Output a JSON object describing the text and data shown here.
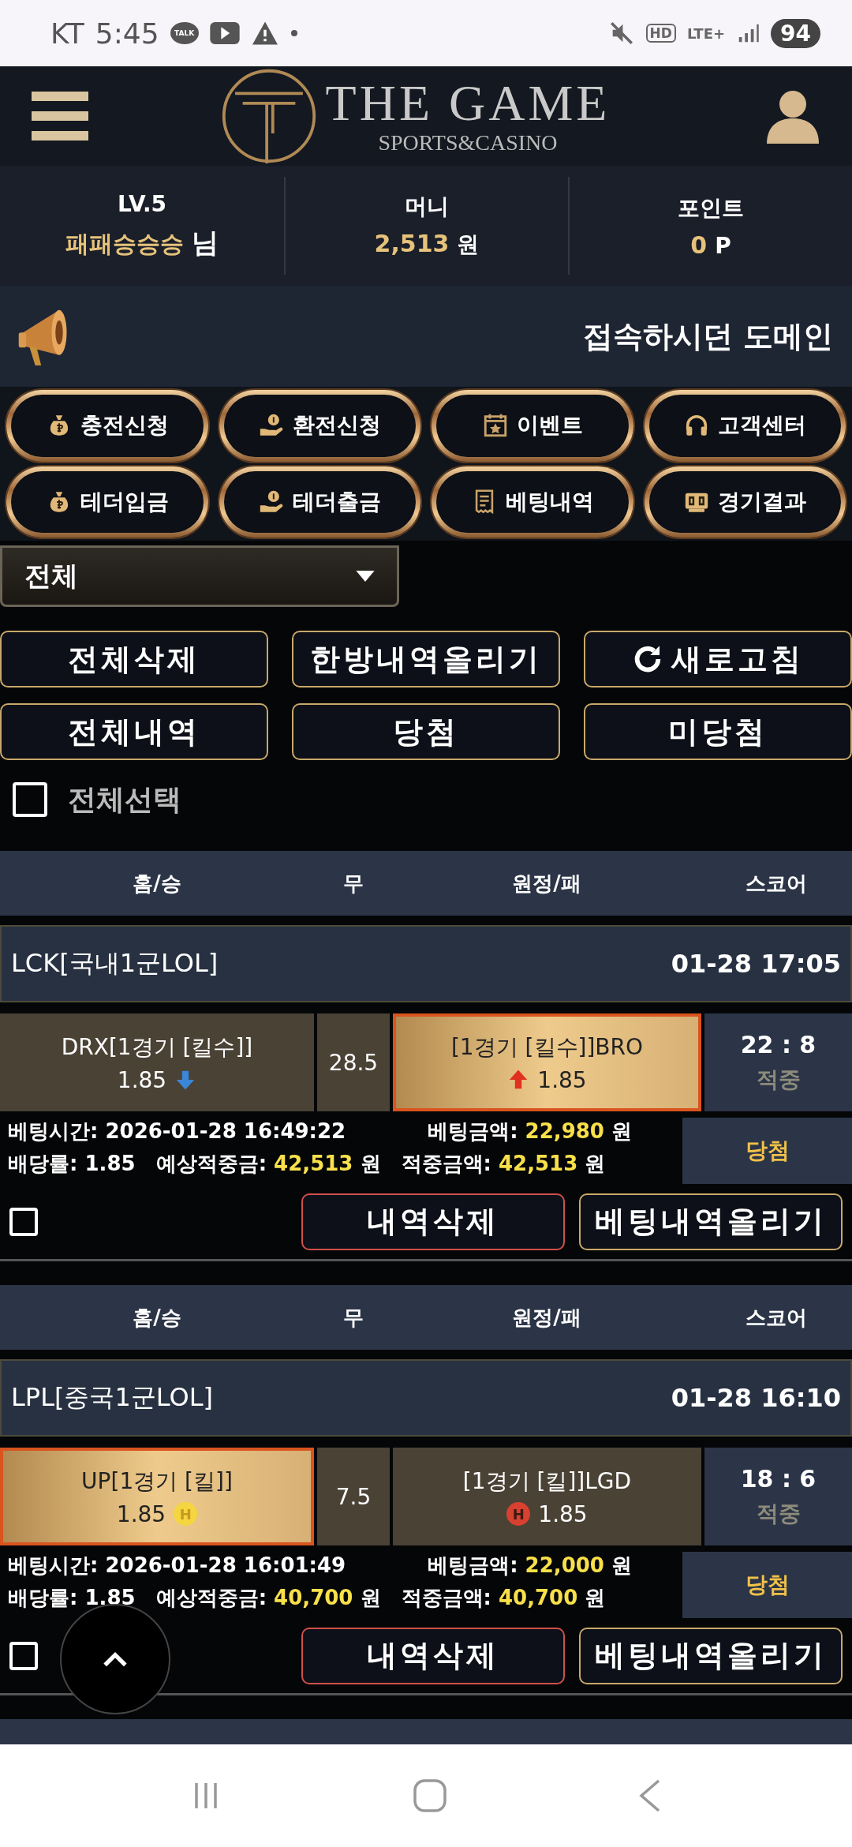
{
  "status_bar": {
    "carrier": "KT",
    "time": "5:45",
    "talk_badge": "TALK",
    "hd": "HD",
    "network": "LTE+",
    "battery": "94"
  },
  "header": {
    "title": "THE GAME",
    "subtitle": "SPORTS&CASINO"
  },
  "user": {
    "level": "LV.5",
    "nickname": "패패승승승",
    "suffix": "님",
    "money_label": "머니",
    "money": "2,513",
    "money_unit": "원",
    "point_label": "포인트",
    "point": "0",
    "point_unit": "P"
  },
  "notice": {
    "text": "접속하시던 도메인"
  },
  "menu": [
    {
      "label": "충전신청",
      "kind": "bag"
    },
    {
      "label": "환전신청",
      "kind": "hand"
    },
    {
      "label": "이벤트",
      "kind": "calendar"
    },
    {
      "label": "고객센터",
      "kind": "headset"
    },
    {
      "label": "테더입금",
      "kind": "bag"
    },
    {
      "label": "테더출금",
      "kind": "hand"
    },
    {
      "label": "베팅내역",
      "kind": "receipt"
    },
    {
      "label": "경기결과",
      "kind": "score"
    }
  ],
  "filter": {
    "value": "전체"
  },
  "actions": [
    {
      "label": "전체삭제",
      "kind": "plain"
    },
    {
      "label": "한방내역올리기",
      "kind": "plain"
    },
    {
      "label": "새로고침",
      "kind": "refresh"
    },
    {
      "label": "전체내역",
      "kind": "plain"
    },
    {
      "label": "당첨",
      "kind": "plain"
    },
    {
      "label": "미당첨",
      "kind": "plain"
    }
  ],
  "select_all": {
    "label": "전체선택",
    "checked": false
  },
  "bets": [
    {
      "columns": [
        "홈/승",
        "무",
        "원정/패",
        "스코어"
      ],
      "league": "LCK[국내1군LOL]",
      "datetime": "01-28 17:05",
      "home": {
        "team": "DRX[1경기 [킬수]]",
        "odds": "1.85",
        "kind": "down",
        "selected": false
      },
      "draw": "28.5",
      "away": {
        "team": "[1경기 [킬수]]BRO",
        "odds": "1.85",
        "kind": "up",
        "selected": true
      },
      "score": "22 : 8",
      "result": "적중",
      "status": "당첨",
      "info_rows": [
        [
          {
            "label": "베팅시간:",
            "value": "2026-01-28 16:49:22",
            "kind": "plain"
          },
          {
            "label": "베팅금액:",
            "value": "22,980",
            "unit": "원",
            "kind": "money"
          }
        ],
        [
          {
            "label": "배당률:",
            "value": "1.85",
            "kind": "plain"
          },
          {
            "label": "예상적중금:",
            "value": "42,513",
            "unit": "원",
            "kind": "money"
          },
          {
            "label": "적중금액:",
            "value": "42,513",
            "unit": "원",
            "kind": "money"
          }
        ]
      ],
      "checked": false,
      "delete_label": "내역삭제",
      "upload_label": "베팅내역올리기"
    },
    {
      "columns": [
        "홈/승",
        "무",
        "원정/패",
        "스코어"
      ],
      "league": "LPL[중국1군LOL]",
      "datetime": "01-28 16:10",
      "home": {
        "team": "UP[1경기 [킬]]",
        "odds": "1.85",
        "kind": "badge-gold",
        "badge": "H",
        "selected": true
      },
      "draw": "7.5",
      "away": {
        "team": "[1경기 [킬]]LGD",
        "odds": "1.85",
        "kind": "badge-red",
        "badge": "H",
        "selected": false
      },
      "score": "18 : 6",
      "result": "적중",
      "status": "당첨",
      "info_rows": [
        [
          {
            "label": "베팅시간:",
            "value": "2026-01-28 16:01:49",
            "kind": "plain"
          },
          {
            "label": "베팅금액:",
            "value": "22,000",
            "unit": "원",
            "kind": "money"
          }
        ],
        [
          {
            "label": "배당률:",
            "value": "1.85",
            "kind": "plain"
          },
          {
            "label": "예상적중금:",
            "value": "40,700",
            "unit": "원",
            "kind": "money"
          },
          {
            "label": "적중금액:",
            "value": "40,700",
            "unit": "원",
            "kind": "money"
          }
        ]
      ],
      "checked": false,
      "delete_label": "내역삭제",
      "upload_label": "베팅내역올리기"
    }
  ]
}
